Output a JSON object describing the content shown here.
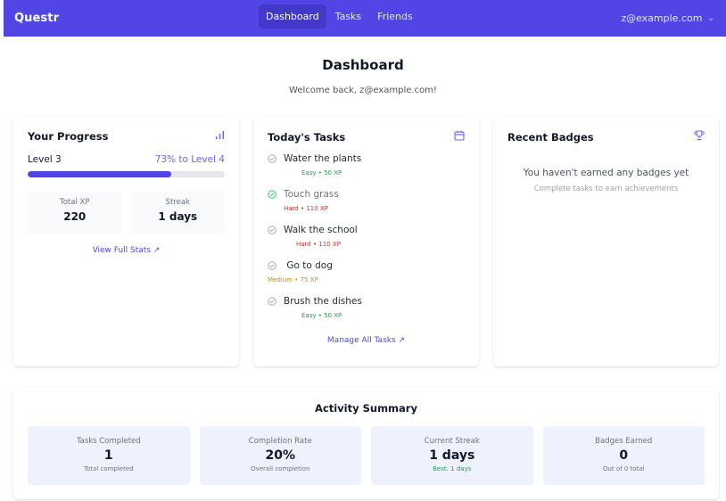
{
  "nav": {
    "brand": "Questr",
    "links": [
      {
        "label": "Dashboard",
        "active": true
      },
      {
        "label": "Tasks",
        "active": false
      },
      {
        "label": "Friends",
        "active": false
      }
    ],
    "user_email": "z@example.com",
    "user_chevron": "⌄"
  },
  "header": {
    "title": "Dashboard",
    "welcome": "Welcome back, z@example.com!"
  },
  "progress": {
    "title": "Your Progress",
    "icon": "bar-chart-icon",
    "level_label": "Level 3",
    "level_pct_text": "73% to Level 4",
    "level_pct_value": 0.73,
    "total_xp_label": "Total XP",
    "total_xp_value": "220",
    "streak_label": "Streak",
    "streak_value": "1 days",
    "view_link": "View Full Stats ↗"
  },
  "tasks": {
    "title": "Today's Tasks",
    "icon": "calendar-icon",
    "items": [
      {
        "title": "Water the plants",
        "meta": "Easy • 50 XP",
        "difficulty": "easy",
        "done": false
      },
      {
        "title": "Touch grass",
        "meta": "Hard • 110 XP",
        "difficulty": "hard",
        "done": true
      },
      {
        "title": "Walk the school",
        "meta": "Hard • 110 XP",
        "difficulty": "hard",
        "done": false
      },
      {
        "title": " Go to dog",
        "meta": "Medium • 75 XP",
        "difficulty": "medium",
        "done": false
      },
      {
        "title": "Brush the dishes",
        "meta": "Easy • 50 XP",
        "difficulty": "easy",
        "done": false
      }
    ],
    "manage_link": "Manage All Tasks ↗"
  },
  "badges": {
    "title": "Recent Badges",
    "icon": "trophy-icon",
    "empty_title": "You haven't earned any badges yet",
    "empty_sub": "Complete tasks to earn achievements"
  },
  "activity": {
    "title": "Activity Summary",
    "items": [
      {
        "label": "Tasks Completed",
        "value": "1",
        "sub": "Total completed"
      },
      {
        "label": "Completion Rate",
        "value": "20%",
        "sub": "Overall completion"
      },
      {
        "label": "Current Streak",
        "value": "1 days",
        "sub": "Best: 1 days"
      },
      {
        "label": "Badges Earned",
        "value": "0",
        "sub": "Out of 0 total"
      }
    ]
  },
  "colors": {
    "nav_bg": "#5145e5",
    "accent": "#4f46e5",
    "easy": "#16a34a",
    "hard": "#dc2626",
    "medium": "#ca8a04"
  }
}
